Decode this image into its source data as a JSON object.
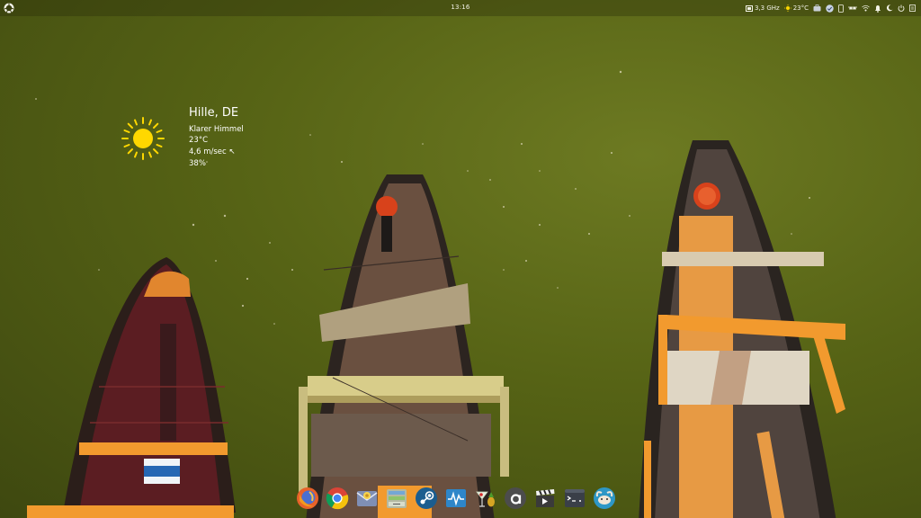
{
  "panel": {
    "clock": "13:16",
    "cpu": "3,3 GHz",
    "temp": "23°C"
  },
  "weather": {
    "city": "Hille, DE",
    "condition": "Klarer Himmel",
    "temperature": "23°C",
    "wind": "4,6 m/sec ↖",
    "humidity": "38%"
  },
  "dock": {
    "apps": [
      {
        "name": "firefox",
        "icon": "firefox-icon"
      },
      {
        "name": "chrome",
        "icon": "chrome-icon"
      },
      {
        "name": "mail",
        "icon": "mail-icon"
      },
      {
        "name": "files",
        "icon": "files-icon"
      },
      {
        "name": "steam",
        "icon": "steam-icon"
      },
      {
        "name": "system-monitor",
        "icon": "monitor-icon"
      },
      {
        "name": "cocktail",
        "icon": "cocktail-icon"
      },
      {
        "name": "anydesk",
        "icon": "a-icon"
      },
      {
        "name": "video-editor",
        "icon": "clapper-icon"
      },
      {
        "name": "terminal",
        "icon": "terminal-icon"
      },
      {
        "name": "messenger",
        "icon": "messenger-icon"
      }
    ]
  },
  "colors": {
    "background": "#566315",
    "sun": "#ffd800",
    "text": "#ffffff"
  }
}
